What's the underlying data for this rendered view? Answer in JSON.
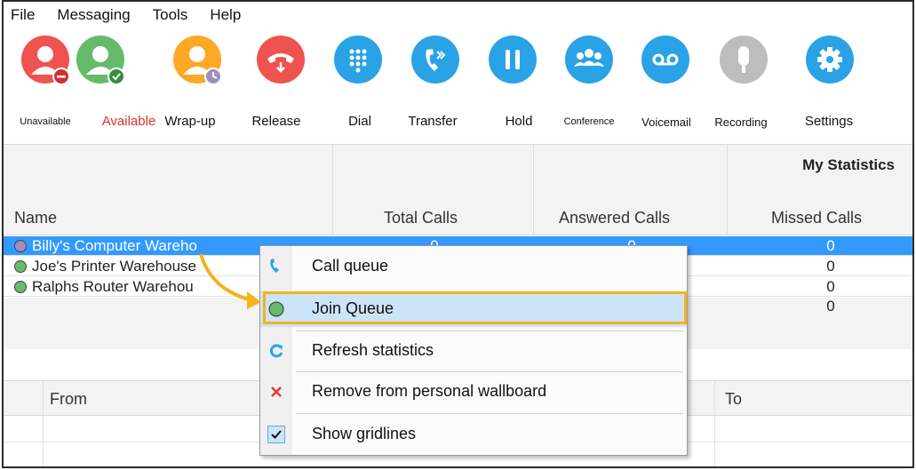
{
  "menu": [
    "File",
    "Messaging",
    "Tools",
    "Help"
  ],
  "toolbar": [
    {
      "label": "Unavailable",
      "icon": "user-unavailable-icon",
      "color": "#ef5350"
    },
    {
      "label": "Available",
      "icon": "user-available-icon",
      "color": "#66bb6a"
    },
    {
      "label": "Wrap-up",
      "icon": "user-wrapup-icon",
      "color": "#ffa726"
    },
    {
      "label": "Release",
      "icon": "phone-release-icon",
      "color": "#ef5350"
    },
    {
      "label": "Dial",
      "icon": "dialpad-icon",
      "color": "#29a3e6"
    },
    {
      "label": "Transfer",
      "icon": "transfer-icon",
      "color": "#29a3e6"
    },
    {
      "label": "Hold",
      "icon": "pause-icon",
      "color": "#29a3e6"
    },
    {
      "label": "Conference",
      "icon": "conference-icon",
      "color": "#29a3e6"
    },
    {
      "label": "Voicemail",
      "icon": "voicemail-icon",
      "color": "#29a3e6"
    },
    {
      "label": "Recording",
      "icon": "microphone-icon",
      "color": "#bdbdbd"
    },
    {
      "label": "Settings",
      "icon": "gear-icon",
      "color": "#29a3e6"
    }
  ],
  "stats": {
    "group_header": "My Statistics",
    "columns": [
      "Name",
      "Total Calls",
      "Answered Calls",
      "Missed Calls"
    ],
    "rows": [
      {
        "name": "Billy's Computer Wareho",
        "total": "0",
        "answered": "0",
        "missed": "0",
        "status_color": "#9b8fc0"
      },
      {
        "name": "Joe's Printer Warehouse",
        "total": "",
        "answered": "",
        "missed": "0",
        "status_color": "#66bb6a"
      },
      {
        "name": "Ralphs Router Warehou",
        "total": "",
        "answered": "",
        "missed": "0",
        "status_color": "#66bb6a"
      }
    ],
    "totals": {
      "missed": "0"
    }
  },
  "calls": {
    "columns": [
      "From",
      "To"
    ]
  },
  "context_menu": {
    "items": [
      {
        "label": "Call queue",
        "icon": "phone-icon"
      },
      {
        "label": "Join Queue",
        "icon": "green-status-icon"
      },
      {
        "label": "Refresh statistics",
        "icon": "refresh-icon"
      },
      {
        "label": "Remove from personal wallboard",
        "icon": "remove-x-icon"
      },
      {
        "label": "Show gridlines",
        "icon": "checkbox-checked-icon"
      }
    ]
  },
  "colors": {
    "highlight": "#f5b21b",
    "selection": "#3399ff",
    "menu_hover": "#cce4f7"
  }
}
